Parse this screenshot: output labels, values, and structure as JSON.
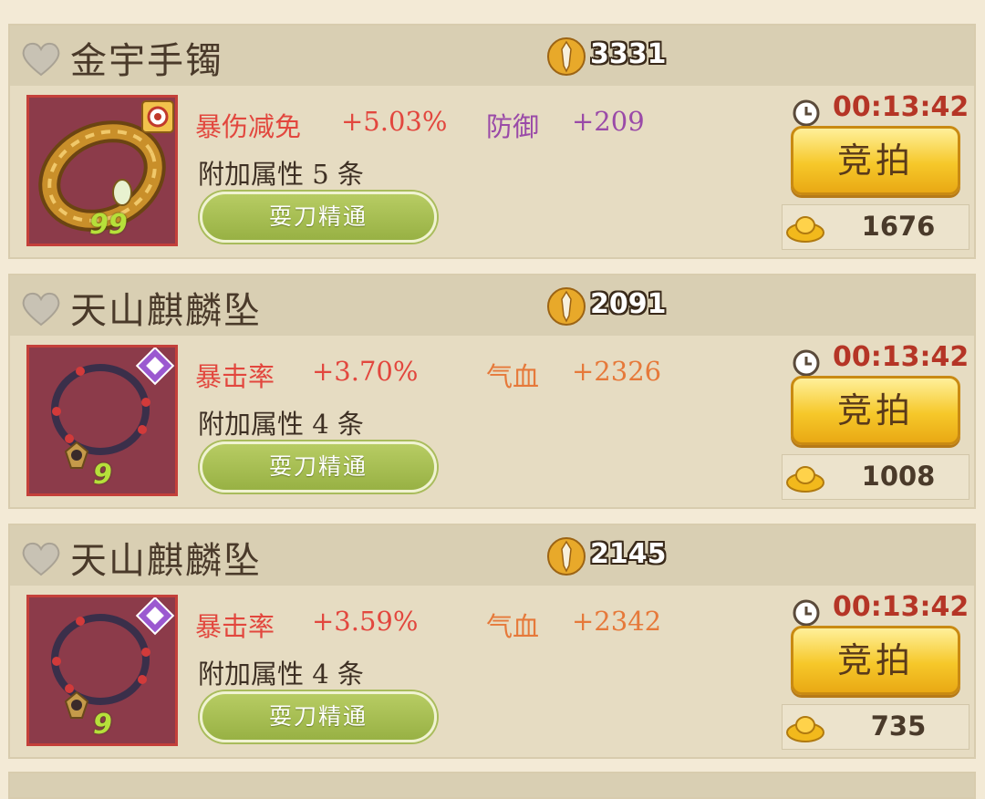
{
  "listings": [
    {
      "name": "金宇手镯",
      "score": "3331",
      "stat1_name": "暴伤减免",
      "stat1_value": "+5.03%",
      "stat2_name": "防御",
      "stat2_value": "+209",
      "stat2_color": "#9a4aa8",
      "extra": "附加属性 5 条",
      "skill": "耍刀精通",
      "level": "99",
      "timer": "00:13:42",
      "bid_label": "竞拍",
      "price": "1676"
    },
    {
      "name": "天山麒麟坠",
      "score": "2091",
      "stat1_name": "暴击率",
      "stat1_value": "+3.70%",
      "stat2_name": "气血",
      "stat2_value": "+2326",
      "stat2_color": "#e6793a",
      "extra": "附加属性 4 条",
      "skill": "耍刀精通",
      "level": "9",
      "timer": "00:13:42",
      "bid_label": "竞拍",
      "price": "1008"
    },
    {
      "name": "天山麒麟坠",
      "score": "2145",
      "stat1_name": "暴击率",
      "stat1_value": "+3.59%",
      "stat2_name": "气血",
      "stat2_value": "+2342",
      "stat2_color": "#e6793a",
      "extra": "附加属性 4 条",
      "skill": "耍刀精通",
      "level": "9",
      "timer": "00:13:42",
      "bid_label": "竞拍",
      "price": "735"
    }
  ]
}
